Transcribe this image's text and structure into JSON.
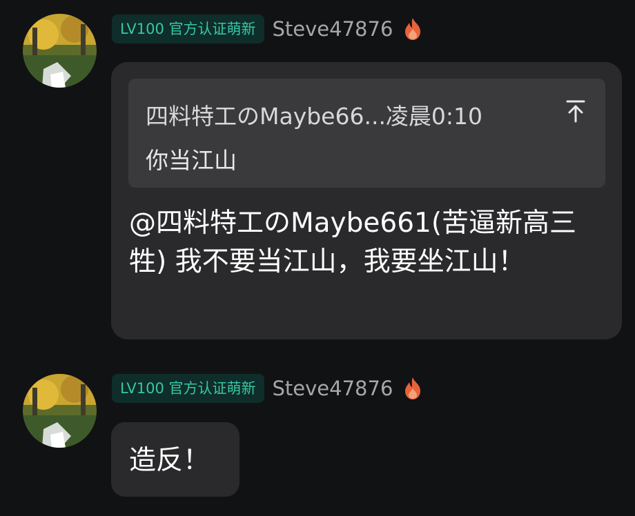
{
  "messages": [
    {
      "badge": "LV100 官方认证萌新",
      "username": "Steve47876",
      "quote": {
        "meta": "四料特工のMaybe66...凌晨0:10",
        "text": "你当江山"
      },
      "text": "@四料特工のMaybe661(苦逼新高三牲) 我不要当江山，我要坐江山！"
    },
    {
      "badge": "LV100 官方认证萌新",
      "username": "Steve47876",
      "text": "造反！"
    }
  ],
  "icons": {
    "fire": "fire-icon",
    "jump_to_quote": "arrow-up-to-top-icon"
  },
  "colors": {
    "background": "#111214",
    "bubble": "#2a2a2c",
    "quote_box": "#3a3a3d",
    "badge_bg": "#0f2d2a",
    "badge_text": "#37c7a6",
    "username": "#a7a7a7",
    "fire": "#e8623a"
  }
}
